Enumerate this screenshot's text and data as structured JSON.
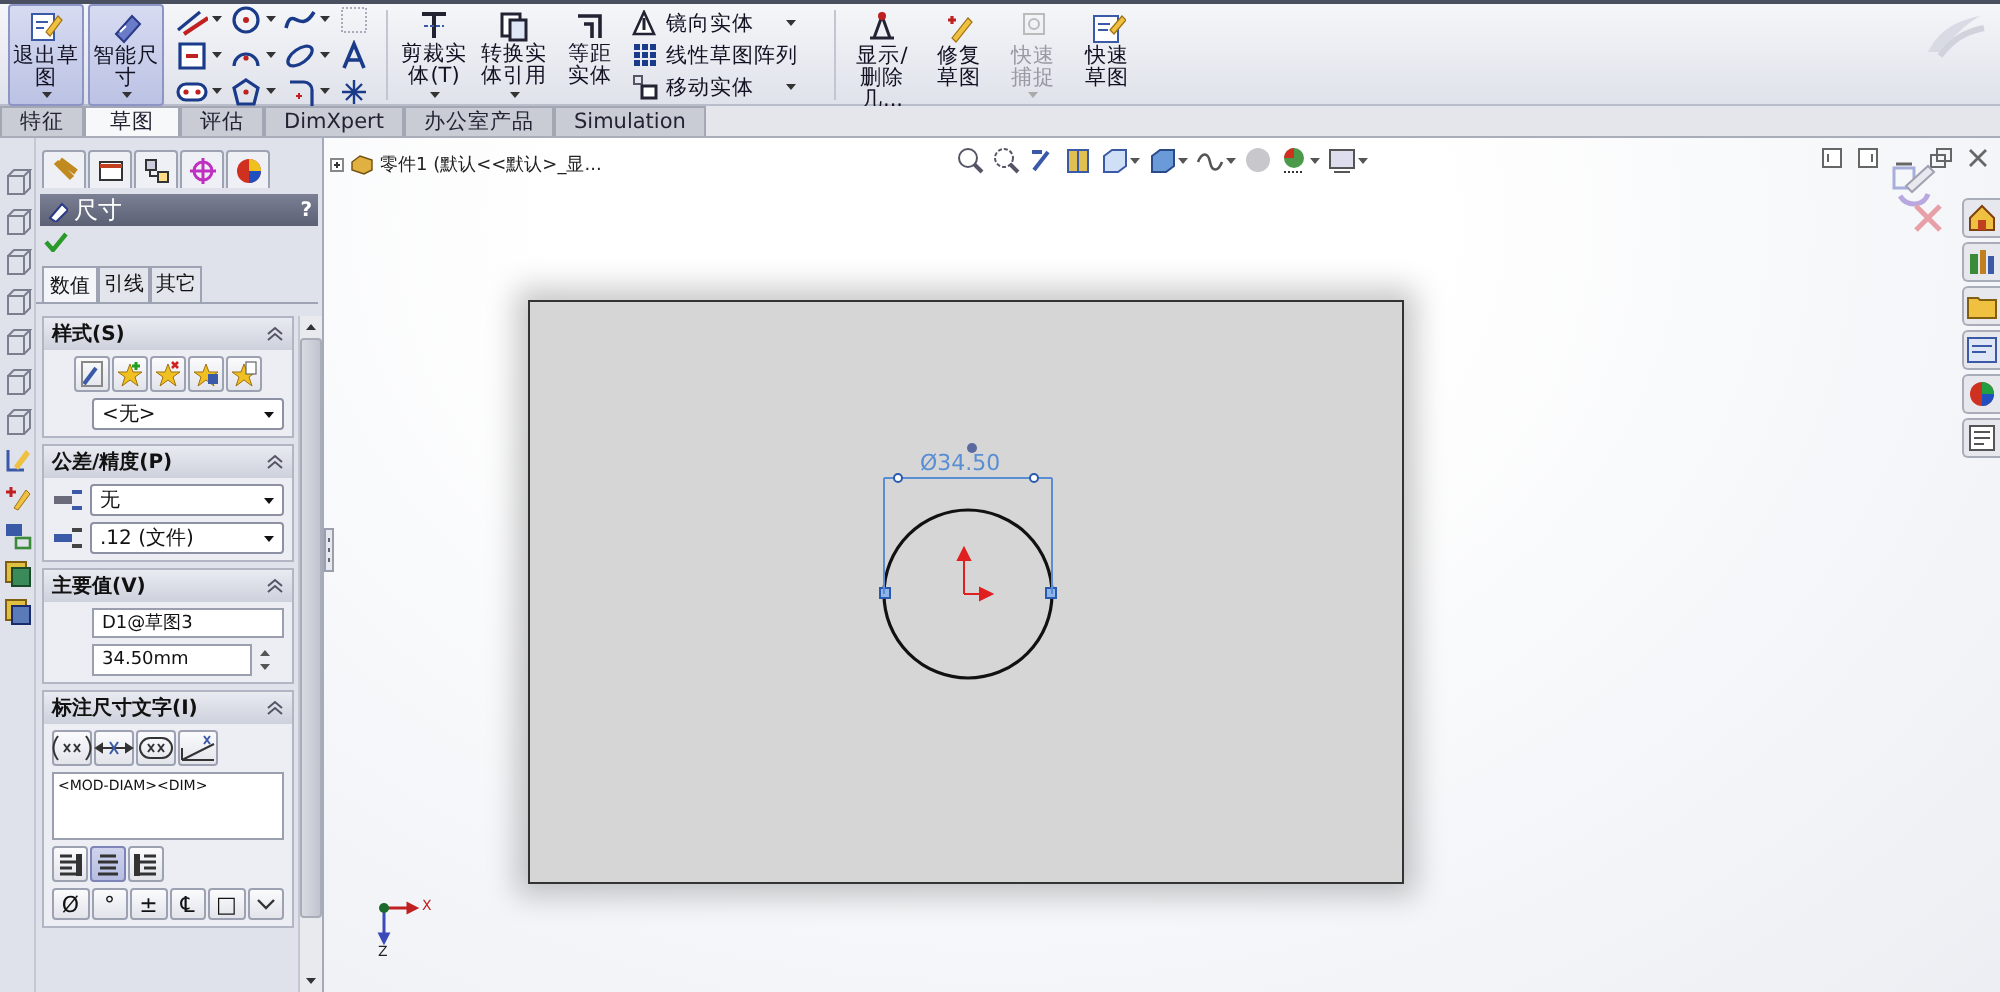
{
  "ribbon": {
    "sketch_buttons": [
      {
        "label": "退出草图",
        "selected": true
      },
      {
        "label": "智能尺寸",
        "selected": true
      }
    ],
    "tool_buttons": [
      {
        "label": "剪裁实体(T)"
      },
      {
        "label": "转换实体引用"
      },
      {
        "label": "等距实体"
      }
    ],
    "small_tools": [
      {
        "label": "镜向实体"
      },
      {
        "label": "线性草图阵列"
      },
      {
        "label": "移动实体"
      }
    ],
    "right_buttons": [
      {
        "label": "显示/删除几...",
        "disabled": false
      },
      {
        "label": "修复草图",
        "disabled": false
      },
      {
        "label": "快速捕捉",
        "disabled": true
      },
      {
        "label": "快速草图",
        "disabled": false
      }
    ]
  },
  "command_tabs": [
    {
      "label": "特征",
      "selected": false
    },
    {
      "label": "草图",
      "selected": true
    },
    {
      "label": "评估",
      "selected": false
    },
    {
      "label": "DimXpert",
      "selected": false
    },
    {
      "label": "办公室产品",
      "selected": false
    },
    {
      "label": "Simulation",
      "selected": false
    }
  ],
  "property_manager": {
    "title": "尺寸",
    "help": "?",
    "tabs": [
      {
        "label": "数值",
        "selected": true
      },
      {
        "label": "引线",
        "selected": false
      },
      {
        "label": "其它",
        "selected": false
      }
    ],
    "style": {
      "title": "样式(S)",
      "value": "<无>"
    },
    "tolerance": {
      "title": "公差/精度(P)",
      "tolerance_value": "无",
      "precision_value": ".12 (文件)"
    },
    "primary_value": {
      "title": "主要值(V)",
      "name": "D1@草图3",
      "value": "34.50mm"
    },
    "dimension_text": {
      "title": "标注尺寸文字(I)",
      "text": "<MOD-DIAM><DIM>",
      "align": [
        {
          "selected": false
        },
        {
          "selected": true
        },
        {
          "selected": false
        }
      ],
      "symbols": [
        "Ø",
        "°",
        "±",
        "℄",
        "□"
      ]
    }
  },
  "graphics": {
    "tree_label": "零件1  (默认<<默认>_显...",
    "dimension": "Ø34.50",
    "axes": [
      "X",
      "Z"
    ]
  }
}
